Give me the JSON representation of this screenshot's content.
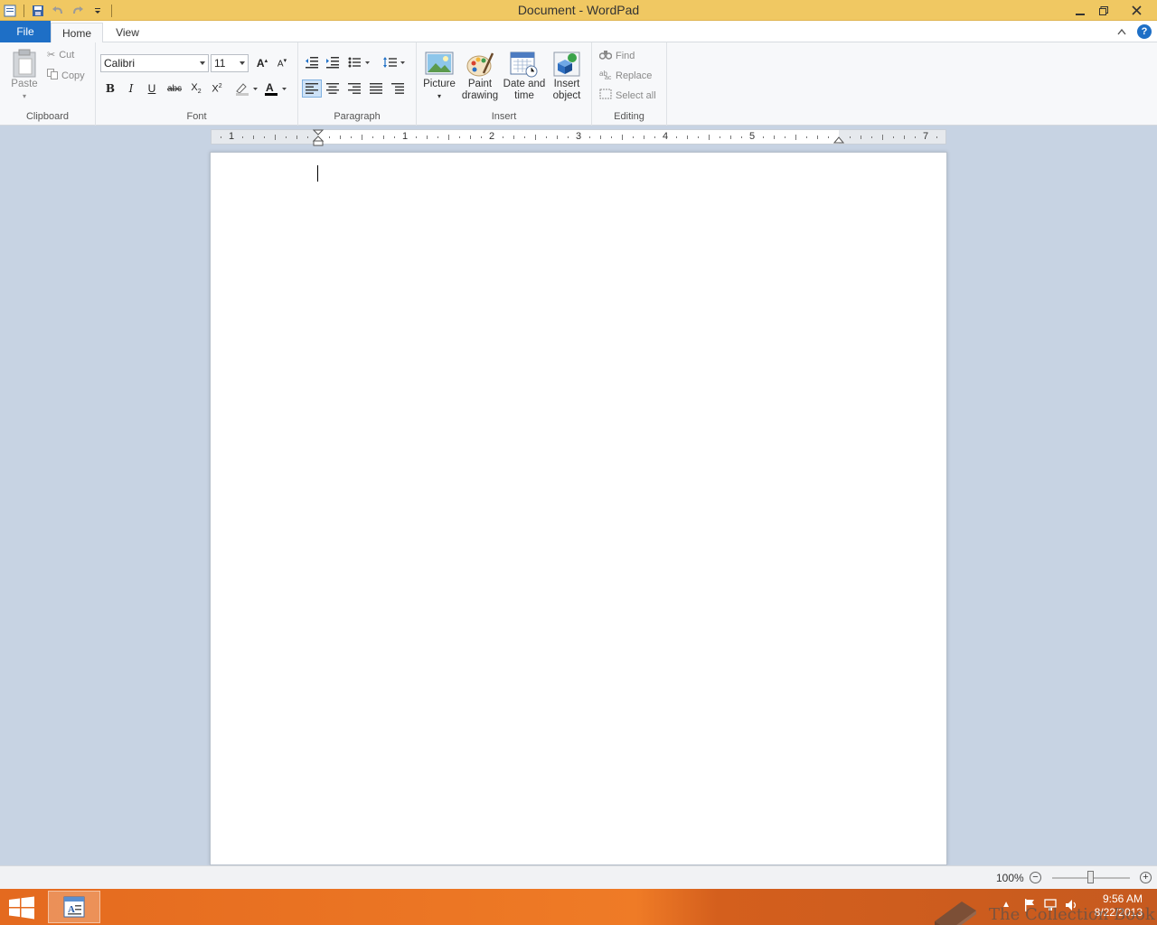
{
  "window": {
    "title": "Document - WordPad"
  },
  "tabs": {
    "file": "File",
    "home": "Home",
    "view": "View"
  },
  "ribbon": {
    "clipboard": {
      "label": "Clipboard",
      "paste": "Paste",
      "cut": "Cut",
      "copy": "Copy"
    },
    "font": {
      "label": "Font",
      "family": "Calibri",
      "size": "11"
    },
    "paragraph": {
      "label": "Paragraph"
    },
    "insert": {
      "label": "Insert",
      "picture": "Picture",
      "paint_line1": "Paint",
      "paint_line2": "drawing",
      "date_line1": "Date and",
      "date_line2": "time",
      "object_line1": "Insert",
      "object_line2": "object"
    },
    "editing": {
      "label": "Editing",
      "find": "Find",
      "replace": "Replace",
      "select_all": "Select all"
    }
  },
  "ruler": {
    "numbers": [
      "1",
      "1",
      "2",
      "3",
      "4",
      "5",
      "7"
    ]
  },
  "status": {
    "zoom": "100%",
    "zoom_level": 1.0
  },
  "taskbar": {
    "time": "9:56 AM",
    "date": "8/22/2013"
  },
  "watermark": {
    "text": "The Collection Book"
  },
  "colors": {
    "titlebar": "#f0c862",
    "file_tab": "#1e6fc6",
    "taskbar": "#ef7b26",
    "workspace": "#c7d3e3"
  }
}
